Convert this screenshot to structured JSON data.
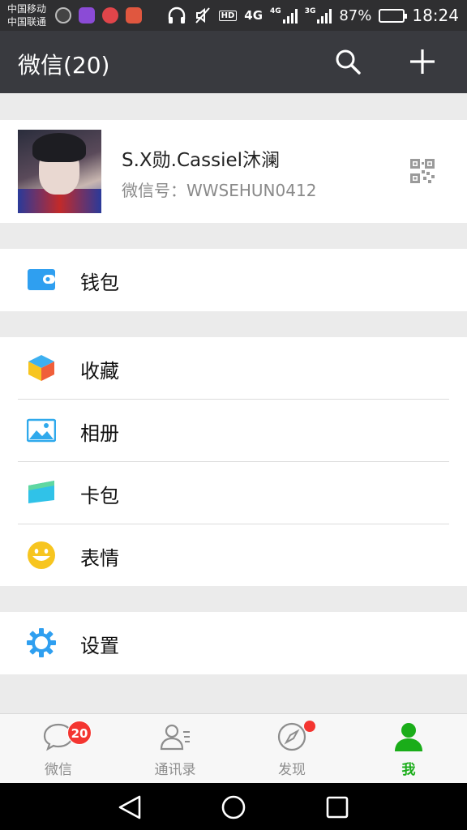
{
  "status_bar": {
    "carrier_1": "中国移动",
    "carrier_2": "中国联通",
    "hd": "HD",
    "net_1": "4G",
    "net_2": "4G",
    "net_3": "3G",
    "battery_text": "87%",
    "battery_level": 0.87,
    "time": "18:24"
  },
  "header": {
    "title": "微信(20)",
    "icons": [
      "search-icon",
      "add-icon"
    ]
  },
  "profile": {
    "nickname": "S.X勋.Cassiel沐澜",
    "wechat_id": "微信号：WWSEHUN0412",
    "qr_icon": "qr-code-icon"
  },
  "menu": {
    "wallet": "钱包",
    "favorites": "收藏",
    "album": "相册",
    "cards": "卡包",
    "stickers": "表情",
    "settings": "设置"
  },
  "tabs": [
    {
      "label": "微信",
      "icon": "chat-icon",
      "badge": "20"
    },
    {
      "label": "通讯录",
      "icon": "contacts-icon"
    },
    {
      "label": "发现",
      "icon": "compass-icon"
    },
    {
      "label": "我",
      "icon": "person-icon",
      "active": true
    }
  ],
  "colors": {
    "accent_green": "#1aad19",
    "badge_red": "#f43530",
    "title_bar": "#393a3f",
    "wallet_blue": "#2f9ff0",
    "sticker_yellow": "#f7c51f"
  }
}
